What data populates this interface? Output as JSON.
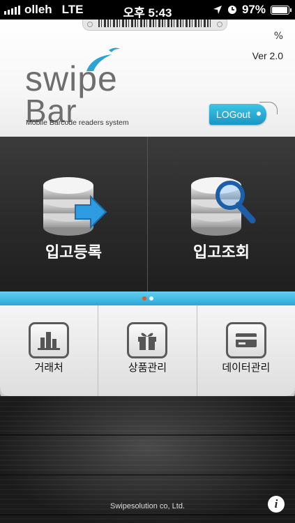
{
  "status_bar": {
    "carrier": "olleh",
    "network": "LTE",
    "time": "오후 5:43",
    "battery": "97%",
    "battery_level": 0.97
  },
  "header": {
    "percent": "%",
    "version": "Ver 2.0",
    "logo_line1": "swipe",
    "logo_line2": "Bar",
    "logo_subtitle": "Mobile Barcode readers system",
    "logout_label": "LOGout"
  },
  "tiles": [
    {
      "label": "입고등록",
      "icon": "database-arrow-icon"
    },
    {
      "label": "입고조회",
      "icon": "database-search-icon"
    }
  ],
  "page_indicator": {
    "count": 2,
    "active": 0,
    "active_color": "#e05a2a",
    "inactive_color": "#e8f4fa"
  },
  "menu": [
    {
      "label": "거래처",
      "icon": "building-icon"
    },
    {
      "label": "상품관리",
      "icon": "gift-icon"
    },
    {
      "label": "데이터관리",
      "icon": "card-icon"
    }
  ],
  "footer": {
    "text": "Swipesolution co, Ltd."
  },
  "colors": {
    "accent": "#2aa6d8",
    "tile_bg": "#2f2f2f",
    "panel_bg": "#eeeeee"
  }
}
